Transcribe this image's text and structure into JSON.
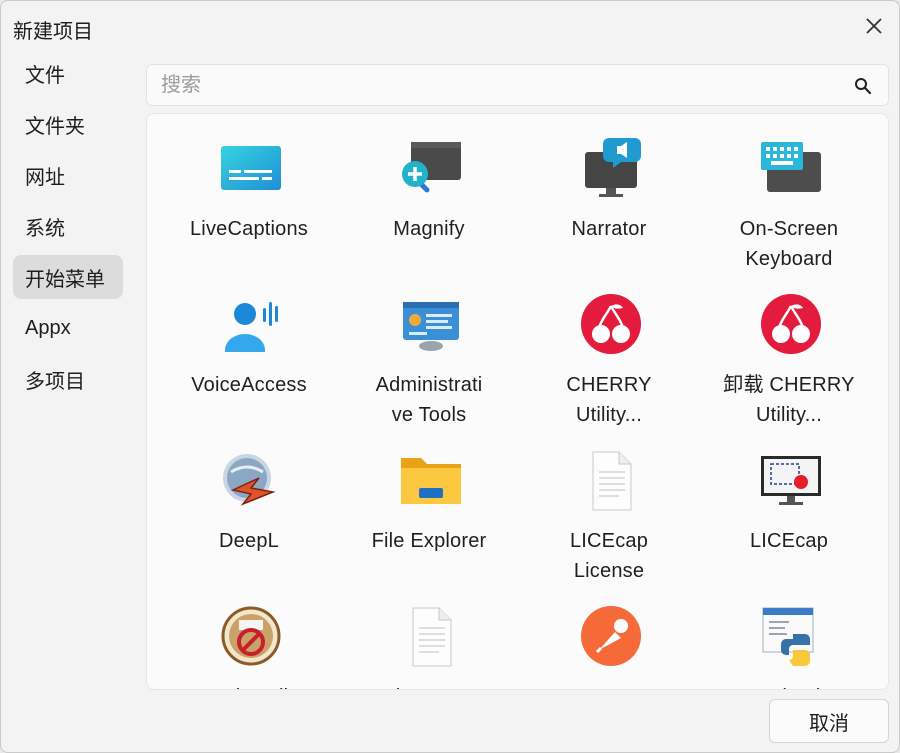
{
  "window": {
    "title": "新建项目"
  },
  "sidebar": {
    "items": [
      {
        "label": "文件"
      },
      {
        "label": "文件夹"
      },
      {
        "label": "网址"
      },
      {
        "label": "系统"
      },
      {
        "label": "开始菜单",
        "active": true
      },
      {
        "label": "Appx"
      },
      {
        "label": "多项目"
      }
    ]
  },
  "search": {
    "placeholder": "搜索",
    "value": ""
  },
  "apps": [
    {
      "label": "LiveCaptions",
      "icon": "live-captions-icon"
    },
    {
      "label": "Magnify",
      "icon": "magnifier-icon"
    },
    {
      "label": "Narrator",
      "icon": "narrator-icon"
    },
    {
      "label": "On-Screen\nKeyboard",
      "icon": "on-screen-keyboard-icon"
    },
    {
      "label": "VoiceAccess",
      "icon": "voice-access-icon"
    },
    {
      "label": "Administrati\nve Tools",
      "icon": "admin-tools-icon"
    },
    {
      "label": "CHERRY\nUtility...",
      "icon": "cherry-icon"
    },
    {
      "label": "卸载 CHERRY\nUtility...",
      "icon": "cherry-uninstall-icon"
    },
    {
      "label": "DeepL",
      "icon": "deepl-icon"
    },
    {
      "label": "File Explorer",
      "icon": "folder-icon"
    },
    {
      "label": "LICEcap\nLicense",
      "icon": "document-icon"
    },
    {
      "label": "LICEcap",
      "icon": "licecap-icon"
    },
    {
      "label": "Uninstall",
      "icon": "uninstall-icon"
    },
    {
      "label": "What's new",
      "icon": "document-icon"
    },
    {
      "label": "Postman",
      "icon": "postman-icon"
    },
    {
      "label": "IDLE (Python",
      "icon": "python-idle-icon"
    }
  ],
  "footer": {
    "cancel_label": "取消"
  },
  "colors": {
    "accent_cherry": "#e31b3c",
    "postman": "#f56a38",
    "active_nav": "#dcdcdc"
  }
}
